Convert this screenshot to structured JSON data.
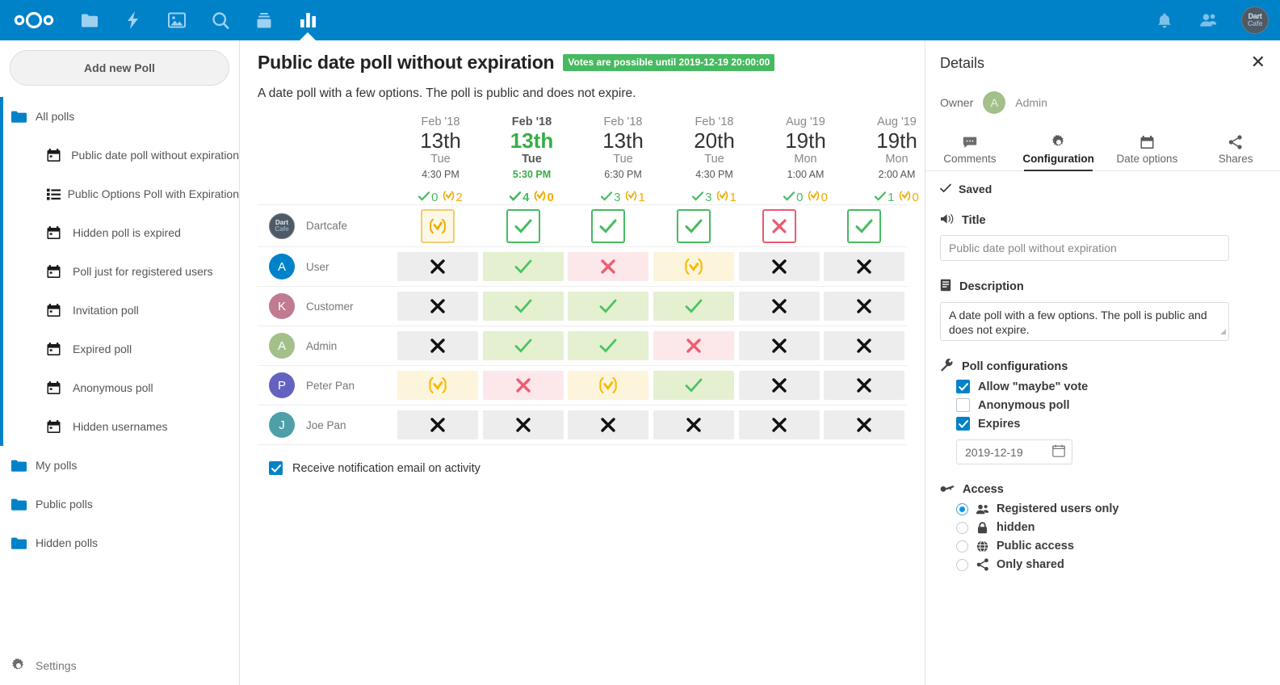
{
  "colors": {
    "brand": "#0082c9",
    "yes": "#46ba61",
    "maybe": "#f0ab00",
    "no": "#ec5a6e",
    "badge_green": "#46ba61",
    "highlight_green": "#37ad47"
  },
  "topbar": {
    "logo_name": "nextcloud-logo",
    "nav_items": [
      {
        "name": "files-icon",
        "label": "Files"
      },
      {
        "name": "activity-icon",
        "label": "Activity"
      },
      {
        "name": "photos-icon",
        "label": "Photos"
      },
      {
        "name": "search-icon",
        "label": "Search"
      },
      {
        "name": "deck-icon",
        "label": "Deck"
      },
      {
        "name": "polls-icon",
        "label": "Polls",
        "active": true
      }
    ],
    "right_items": [
      {
        "name": "notifications-bell-icon",
        "label": "Notifications"
      },
      {
        "name": "contacts-icon",
        "label": "Contacts"
      }
    ],
    "avatar": {
      "line1": "Dart",
      "line2": "Cafe"
    }
  },
  "sidebar": {
    "add_poll_label": "Add new Poll",
    "groups": [
      {
        "label": "All polls",
        "icon": "folder-icon",
        "active": true,
        "items": [
          {
            "label": "Public date poll without expiration",
            "icon": "calendar-icon"
          },
          {
            "label": "Public Options Poll with Expiration",
            "icon": "list-icon"
          },
          {
            "label": "Hidden poll is expired",
            "icon": "calendar-icon"
          },
          {
            "label": "Poll just for registered users",
            "icon": "calendar-icon"
          },
          {
            "label": "Invitation poll",
            "icon": "calendar-icon"
          },
          {
            "label": "Expired poll",
            "icon": "calendar-icon"
          },
          {
            "label": "Anonymous poll",
            "icon": "calendar-icon"
          },
          {
            "label": "Hidden usernames",
            "icon": "calendar-icon"
          }
        ]
      },
      {
        "label": "My polls",
        "icon": "folder-icon",
        "items": []
      },
      {
        "label": "Public polls",
        "icon": "folder-icon",
        "items": []
      },
      {
        "label": "Hidden polls",
        "icon": "folder-icon",
        "items": []
      }
    ],
    "settings_label": "Settings",
    "settings_icon": "gear-icon"
  },
  "main": {
    "poll_title": "Public date poll without expiration",
    "expiry_badge": "Votes are possible until 2019-12-19 20:00:00",
    "description": "A date poll with a few options. The poll is public and does not expire.",
    "notification_label": "Receive notification email on activity",
    "notification_checked": true
  },
  "poll_table": {
    "columns": [
      {
        "month": "Feb '18",
        "day": "13th",
        "dow": "Tue",
        "time": "4:30 PM",
        "yes_count": "0",
        "maybe_count": "2",
        "highlight": false
      },
      {
        "month": "Feb '18",
        "day": "13th",
        "dow": "Tue",
        "time": "5:30 PM",
        "yes_count": "4",
        "maybe_count": "0",
        "highlight": true
      },
      {
        "month": "Feb '18",
        "day": "13th",
        "dow": "Tue",
        "time": "6:30 PM",
        "yes_count": "3",
        "maybe_count": "1",
        "highlight": false
      },
      {
        "month": "Feb '18",
        "day": "20th",
        "dow": "Tue",
        "time": "4:30 PM",
        "yes_count": "3",
        "maybe_count": "1",
        "highlight": false
      },
      {
        "month": "Aug '19",
        "day": "19th",
        "dow": "Mon",
        "time": "1:00 AM",
        "yes_count": "0",
        "maybe_count": "0",
        "highlight": false
      },
      {
        "month": "Aug '19",
        "day": "19th",
        "dow": "Mon",
        "time": "2:00 AM",
        "yes_count": "1",
        "maybe_count": "0",
        "highlight": false
      }
    ],
    "rows": [
      {
        "name": "Dartcafe",
        "avatar_type": "logo",
        "avatar_initial": "",
        "avatar_color": "#4e5a66",
        "own_row": true,
        "votes": [
          "maybe",
          "yes",
          "yes",
          "yes",
          "nored",
          "yes"
        ]
      },
      {
        "name": "User",
        "avatar_type": "initial",
        "avatar_initial": "A",
        "avatar_color": "#0082c9",
        "own_row": false,
        "votes": [
          "no",
          "yes",
          "nored",
          "maybe",
          "no",
          "no"
        ]
      },
      {
        "name": "Customer",
        "avatar_type": "initial",
        "avatar_initial": "K",
        "avatar_color": "#c07b90",
        "own_row": false,
        "votes": [
          "no",
          "yes",
          "yes",
          "yes",
          "no",
          "no"
        ]
      },
      {
        "name": "Admin",
        "avatar_type": "initial",
        "avatar_initial": "A",
        "avatar_color": "#a3c08b",
        "own_row": false,
        "votes": [
          "no",
          "yes",
          "yes",
          "nored",
          "no",
          "no"
        ]
      },
      {
        "name": "Peter Pan",
        "avatar_type": "initial",
        "avatar_initial": "P",
        "avatar_color": "#6462c0",
        "own_row": false,
        "votes": [
          "maybe",
          "nored",
          "maybe",
          "yes",
          "no",
          "no"
        ]
      },
      {
        "name": "Joe Pan",
        "avatar_type": "initial",
        "avatar_initial": "J",
        "avatar_color": "#4e9fa8",
        "own_row": false,
        "votes": [
          "no",
          "no",
          "no",
          "no",
          "no",
          "no"
        ]
      }
    ]
  },
  "details": {
    "title": "Details",
    "close_icon": "close-icon",
    "owner_label": "Owner",
    "owner_name": "Admin",
    "owner_initial": "A",
    "owner_avatar_color": "#a3c08b",
    "tabs": [
      {
        "label": "Comments",
        "icon": "comment-icon",
        "active": false
      },
      {
        "label": "Configuration",
        "icon": "gear-icon",
        "active": true
      },
      {
        "label": "Date options",
        "icon": "calendar-icon",
        "active": false
      },
      {
        "label": "Shares",
        "icon": "share-icon",
        "active": false
      }
    ],
    "saved_label": "Saved",
    "saved_icon": "check-icon",
    "title_section": {
      "label": "Title",
      "icon": "megaphone-icon",
      "value": "Public date poll without expiration"
    },
    "description_section": {
      "label": "Description",
      "icon": "document-icon",
      "value": "A date poll with a few options. The poll is public and does not expire."
    },
    "config_section": {
      "label": "Poll configurations",
      "icon": "wrench-icon",
      "options": [
        {
          "label": "Allow \"maybe\" vote",
          "checked": true
        },
        {
          "label": "Anonymous poll",
          "checked": false
        },
        {
          "label": "Expires",
          "checked": true
        }
      ],
      "expiry_date": "2019-12-19",
      "expiry_icon": "calendar-icon"
    },
    "access_section": {
      "label": "Access",
      "icon": "key-icon",
      "options": [
        {
          "label": "Registered users only",
          "icon": "group-icon",
          "selected": true
        },
        {
          "label": "hidden",
          "icon": "lock-icon",
          "selected": false
        },
        {
          "label": "Public access",
          "icon": "globe-icon",
          "selected": false
        },
        {
          "label": "Only shared",
          "icon": "share-icon",
          "selected": false
        }
      ]
    }
  }
}
